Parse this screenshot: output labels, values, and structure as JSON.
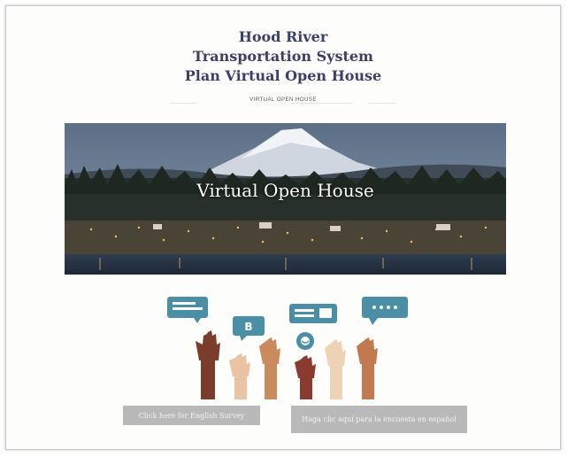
{
  "page": {
    "title_lines": [
      "Hood River",
      "Transportation System",
      "Plan Virtual Open House"
    ]
  },
  "nav": {
    "active_label": "VIRTUAL OPEN HOUSE"
  },
  "hero": {
    "caption": "Virtual Open House"
  },
  "illustration": {
    "bubble_b_letter": "B"
  },
  "buttons": {
    "english_survey": "Click here for English Survey",
    "spanish_survey": "Haga clic aquí para la encuesta en español"
  },
  "colors": {
    "title": "#3a3f6b",
    "bubble": "#4a8fa6",
    "button": "#b9b9b9"
  }
}
